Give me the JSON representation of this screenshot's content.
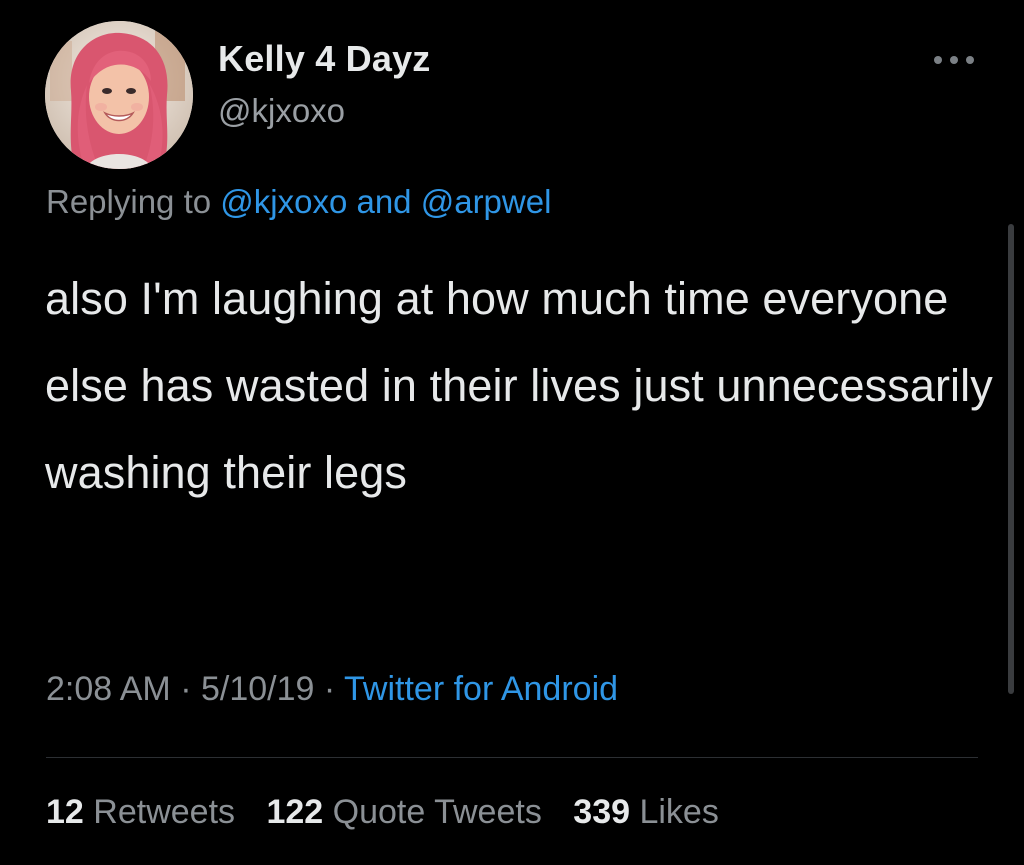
{
  "user": {
    "display_name": "Kelly 4 Dayz",
    "handle": "@kjxoxo",
    "avatar_icon": "profile-photo"
  },
  "header": {
    "more_icon": "more-horizontal-icon"
  },
  "reply": {
    "prefix": "Replying to ",
    "mention_1": "@kjxoxo",
    "conjunction": " and ",
    "mention_2": "@arpwel"
  },
  "tweet": {
    "text": "also I'm laughing at how much time everyone else has wasted in their lives just unnecessarily washing their legs"
  },
  "meta": {
    "time": "2:08 AM",
    "separator_1": " · ",
    "date": "5/10/19",
    "separator_2": " · ",
    "source": "Twitter for Android"
  },
  "stats": {
    "retweets_count": "12",
    "retweets_label": "Retweets",
    "quotes_count": "122",
    "quotes_label": "Quote Tweets",
    "likes_count": "339",
    "likes_label": "Likes"
  },
  "colors": {
    "background": "#000000",
    "text_primary": "#e7e9ea",
    "text_secondary": "#8b9095",
    "link": "#2f96e6"
  }
}
